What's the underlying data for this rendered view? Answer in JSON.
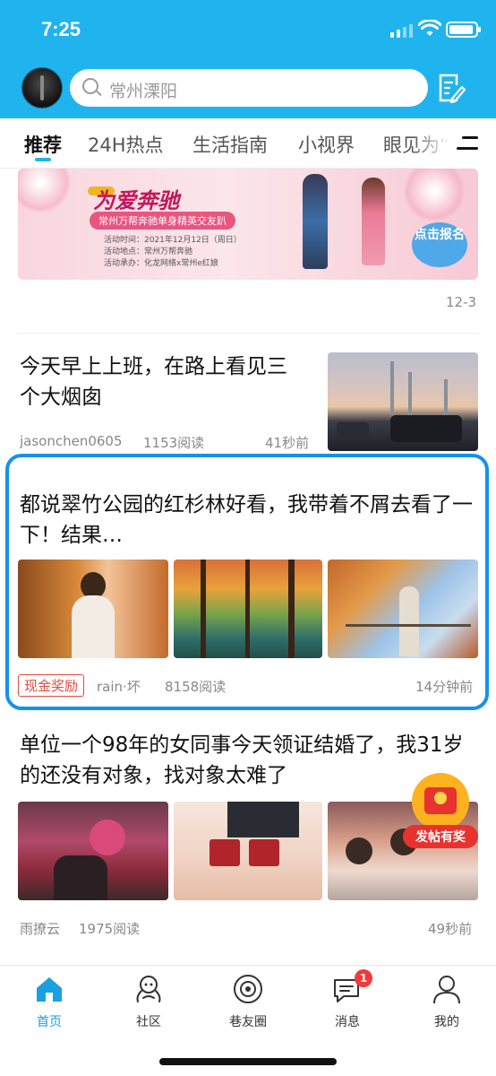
{
  "status_bar": {
    "time": "7:25"
  },
  "header": {
    "search_placeholder": "常州溧阳"
  },
  "tabs": [
    {
      "label": "推荐",
      "active": true
    },
    {
      "label": "24H热点"
    },
    {
      "label": "生活指南"
    },
    {
      "label": "小视界"
    },
    {
      "label": "眼见为“"
    }
  ],
  "banner": {
    "title": "为爱奔驰",
    "subtitle": "常州万帮奔驰单身精英交友趴",
    "info": [
      "活动时间：2021年12月12日（周日）",
      "活动地点：常州万帮奔驰",
      "活动承办：化龙网络x常州e红娘"
    ],
    "cta": "点击报名",
    "date": "12-3"
  },
  "posts": [
    {
      "title": "今天早上上班，在路上看见三个大烟囱",
      "author": "jasonchen0605",
      "reads": "1153阅读",
      "time": "41秒前"
    },
    {
      "title": "都说翠竹公园的红杉林好看，我带着不屑去看了一下！结果…",
      "badge": "现金奖励",
      "author": "rain·坏",
      "reads": "8158阅读",
      "time": "14分钟前"
    },
    {
      "title": "单位一个98年的女同事今天领证结婚了，我31岁的还没有对象，找对象太难了",
      "author": "雨撩云",
      "reads": "1975阅读",
      "time": "49秒前",
      "promo": "发帖有奖"
    }
  ],
  "bottom_nav": [
    {
      "label": "首页",
      "icon": "home-icon",
      "active": true
    },
    {
      "label": "社区",
      "icon": "community-icon"
    },
    {
      "label": "巷友圈",
      "icon": "circle-icon"
    },
    {
      "label": "消息",
      "icon": "message-icon",
      "badge": "1"
    },
    {
      "label": "我的",
      "icon": "profile-icon"
    }
  ],
  "colors": {
    "brand": "#20b4ef",
    "active_tab": "#1a9fe0",
    "badge_red": "#f23a3a",
    "highlight": "#1493e6"
  }
}
